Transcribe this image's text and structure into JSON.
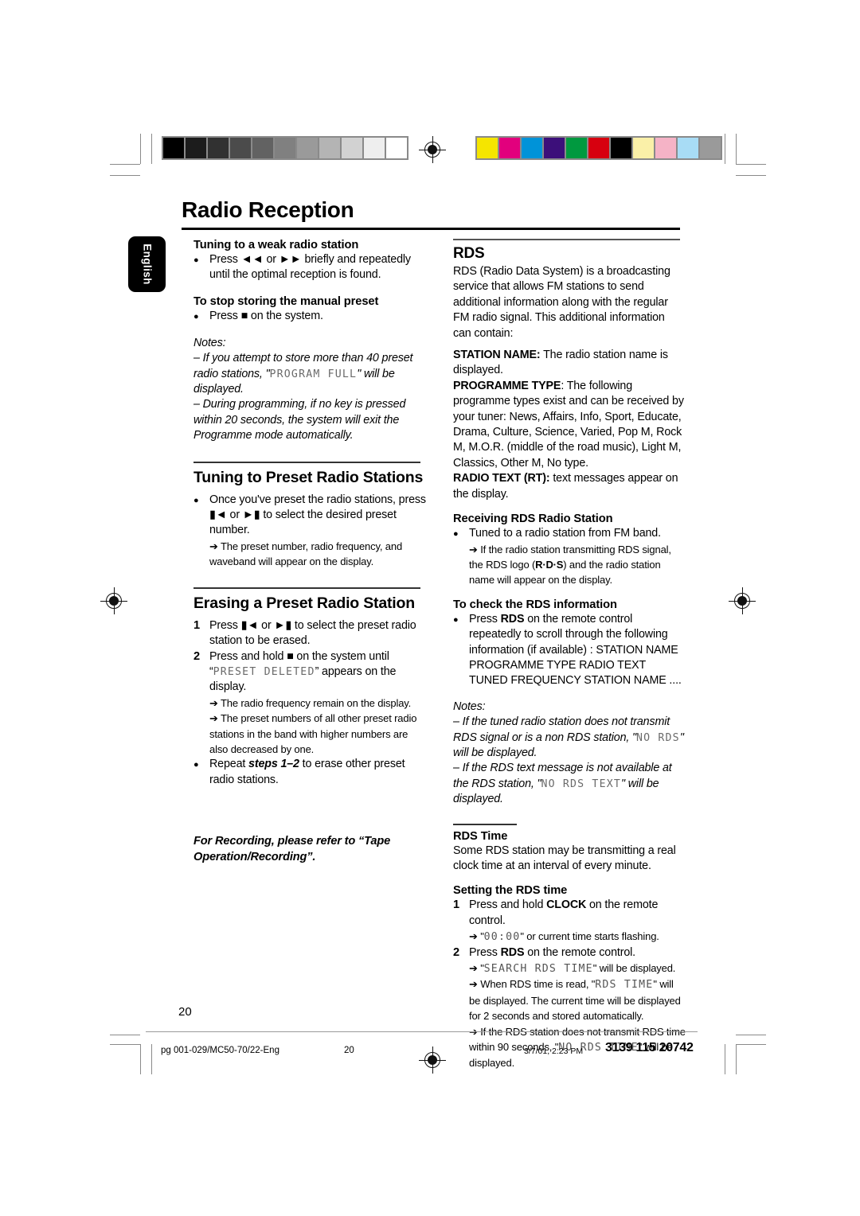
{
  "document": {
    "title": "Radio Reception",
    "language_tab": "English",
    "page_number": "20"
  },
  "calibration": {
    "gray_bar": [
      "#000000",
      "#1c1c1c",
      "#313131",
      "#4b4b4b",
      "#626262",
      "#808080",
      "#9a9a9a",
      "#b4b4b4",
      "#d2d2d2",
      "#eeeeee",
      "#ffffff"
    ],
    "color_bar": [
      "#f5e500",
      "#e2007d",
      "#0093d8",
      "#3c0f7a",
      "#00993f",
      "#d7000f",
      "#000000",
      "#faf0a8",
      "#f5b3c6",
      "#a8dcf5",
      "#9a9a9a"
    ]
  },
  "left_column": {
    "sub1": {
      "heading": "Tuning to a weak radio station",
      "bullet": "Press ◄◄ or ►► briefly and repeatedly until the optimal reception is found."
    },
    "sub2": {
      "heading": "To stop storing the manual preset",
      "bullet": "Press ■ on the system."
    },
    "notes": {
      "label": "Notes:",
      "note1_a": "–  If you attempt to store more than 40 preset radio stations, \"",
      "note1_lcd": "PROGRAM FULL",
      "note1_b": "\" will be displayed.",
      "note2": "–  During programming, if no key is pressed within 20 seconds, the system will exit the Programme mode automatically."
    },
    "sec_preset": {
      "heading": "Tuning to Preset Radio Stations",
      "bullet": "Once you've preset the radio stations, press ▮◄ or ►▮ to select the desired preset number.",
      "arrow": "➔ The preset number, radio frequency, and waveband will appear on the display."
    },
    "sec_erase": {
      "heading": "Erasing a Preset Radio Station",
      "step1_num": "1",
      "step1": "Press ▮◄ or ►▮ to select the preset radio station to be erased.",
      "step2_num": "2",
      "step2_a": "Press and hold ■ on the system until “",
      "step2_lcd": "PRESET DELETED",
      "step2_b": "” appears on the display.",
      "step2_arrow1": "➔ The radio frequency remain on the display.",
      "step2_arrow2": "➔ The preset numbers of all other preset radio stations in the band with higher numbers are also decreased by one.",
      "bullet_a": "Repeat ",
      "bullet_bold": "steps 1–2",
      "bullet_b": " to erase other preset radio stations."
    },
    "recording_note": "For Recording, please refer to “Tape Operation/Recording”."
  },
  "right_column": {
    "rds": {
      "heading": "RDS",
      "intro": "RDS (Radio Data System) is a broadcasting service that allows FM stations to send additional information along with the regular FM radio signal. This additional information can contain:",
      "station_name_label": "STATION NAME:",
      "station_name_text": " The radio station name is displayed.",
      "programme_type_label": "PROGRAMME TYPE",
      "programme_type_text": ": The following programme types exist and can be received by your tuner: News, Affairs, Info, Sport, Educate, Drama, Culture, Science, Varied, Pop M, Rock M, M.O.R. (middle of the road music), Light M, Classics, Other M, No type.",
      "radio_text_label": "RADIO TEXT (RT):",
      "radio_text_text": " text messages appear on the display."
    },
    "receiving": {
      "heading": "Receiving RDS Radio Station",
      "bullet": "Tuned to a radio station from FM band.",
      "arrow_a": "➔ If the radio station transmitting RDS signal, the RDS logo (",
      "arrow_logo": "R·D·S",
      "arrow_b": ") and the radio station name will appear on the display."
    },
    "check": {
      "heading": "To check the RDS information",
      "bullet_a": "Press ",
      "bullet_bold": "RDS",
      "bullet_b": " on the remote control repeatedly to scroll through the following information (if available) : STATION NAME    PROGRAMME TYPE    RADIO TEXT    TUNED FREQUENCY    STATION NAME ...."
    },
    "notes": {
      "label": "Notes:",
      "note1_a": "–  If the tuned radio station does not transmit RDS signal or is a non RDS station, \"",
      "note1_lcd": "NO RDS",
      "note1_b": "\" will be displayed.",
      "note2_a": "–  If the RDS text message is not available at the RDS station, \"",
      "note2_lcd": "NO RDS TEXT",
      "note2_b": "\" will be displayed."
    },
    "rds_time": {
      "heading": "RDS Time",
      "text": "Some RDS station may be transmitting a real clock time at an interval of every minute."
    },
    "setting": {
      "heading": "Setting the RDS time",
      "step1_num": "1",
      "step1_a": "Press and hold ",
      "step1_bold": "CLOCK",
      "step1_b": " on the remote control.",
      "step1_arrow_a": "➔ \"",
      "step1_arrow_lcd": "00:00",
      "step1_arrow_b": "\" or current time starts flashing.",
      "step2_num": "2",
      "step2_a": "Press ",
      "step2_bold": "RDS",
      "step2_b": " on the remote control.",
      "step2_arrow1_a": "➔ \"",
      "step2_arrow1_lcd": "SEARCH RDS TIME",
      "step2_arrow1_b": "\" will be displayed.",
      "step2_arrow2_a": "➔ When RDS time is read, \"",
      "step2_arrow2_lcd": "RDS TIME",
      "step2_arrow2_b": "\" will be displayed. The current time will be displayed for 2 seconds and stored automatically.",
      "step2_arrow3_a": "➔ If the RDS station does not transmit RDS time within 90 seconds, \"",
      "step2_arrow3_lcd": "NO RDS TIME",
      "step2_arrow3_b": "\" will be displayed."
    }
  },
  "footer": {
    "filename": "pg 001-029/MC50-70/22-Eng",
    "page": "20",
    "date": "3/7/01, 2:23 PM",
    "code": "3139 115 20742"
  }
}
